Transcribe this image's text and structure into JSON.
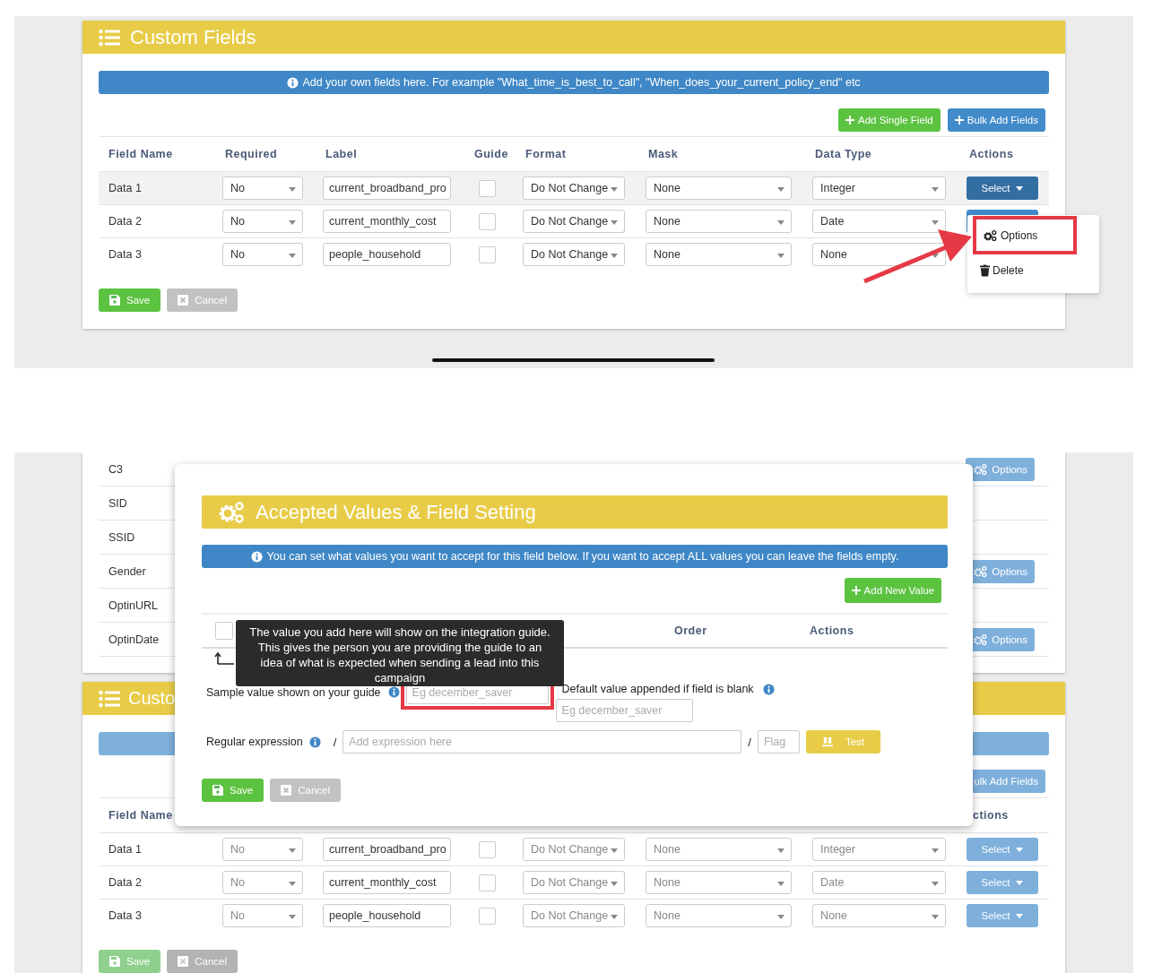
{
  "top": {
    "card": {
      "title": "Custom Fields",
      "info": "Add your own fields here. For example \"What_time_is_best_to_call\", \"When_does_your_current_policy_end\" etc",
      "buttons": [
        {
          "label": "Add Single Field",
          "kind": "success"
        },
        {
          "label": "Bulk Add Fields",
          "kind": "primary"
        }
      ],
      "columns": [
        "Field Name",
        "Required",
        "Label",
        "Guide",
        "Format",
        "Mask",
        "Data Type",
        "Actions"
      ],
      "rows": [
        {
          "name": "Data 1",
          "required": "No",
          "label": "current_broadband_pro",
          "guide": false,
          "format": "Do Not Change",
          "mask": "None",
          "data_type": "Integer",
          "action": {
            "label": "Select",
            "kind": "active"
          },
          "selected": true
        },
        {
          "name": "Data 2",
          "required": "No",
          "label": "current_monthly_cost",
          "guide": false,
          "format": "Do Not Change",
          "mask": "None",
          "data_type": "Date",
          "action": {
            "kind": "covered"
          },
          "selected": false
        },
        {
          "name": "Data 3",
          "required": "No",
          "label": "people_household",
          "guide": false,
          "format": "Do Not Change",
          "mask": "None",
          "data_type": "None",
          "selected": false
        }
      ],
      "footer_buttons": [
        {
          "label": "Save",
          "kind": "save"
        },
        {
          "label": "Cancel",
          "kind": "cancel"
        }
      ]
    },
    "dropdown_menu": {
      "items": [
        {
          "label": "Options",
          "kind": "options",
          "annotated": true
        },
        {
          "label": "Delete",
          "kind": "delete",
          "annotated": false
        }
      ]
    }
  },
  "bottom": {
    "background_rows": [
      {
        "name": "C3",
        "action": "Options"
      },
      {
        "name": "SID"
      },
      {
        "name": "SSID"
      },
      {
        "name": "Gender",
        "action": "Options"
      },
      {
        "name": "OptinURL"
      },
      {
        "name": "OptinDate",
        "action": "Options"
      }
    ],
    "card": {
      "title": "Custo",
      "buttons": [
        {
          "label": "ulk Add Fields",
          "kind": "primary"
        }
      ],
      "columns": [
        "Field Name",
        "ctions"
      ],
      "rows": [
        {
          "name": "Data 1",
          "required": "No",
          "label": "current_broadband_pro",
          "guide": false,
          "format": "Do Not Change",
          "mask": "None",
          "data_type": "Integer",
          "action": {
            "label": "Select",
            "kind": "normal"
          },
          "selected": false
        },
        {
          "name": "Data 2",
          "required": "No",
          "label": "current_monthly_cost",
          "guide": false,
          "format": "Do Not Change",
          "mask": "None",
          "data_type": "Date",
          "action": {
            "label": "Select",
            "kind": "normal"
          },
          "selected": false
        },
        {
          "name": "Data 3",
          "required": "No",
          "label": "people_household",
          "guide": false,
          "format": "Do Not Change",
          "mask": "None",
          "data_type": "None",
          "action": {
            "label": "Select",
            "kind": "normal"
          },
          "selected": false
        }
      ],
      "footer_buttons": [
        {
          "label": "Save",
          "kind": "save"
        },
        {
          "label": "Cancel",
          "kind": "cancel"
        }
      ]
    },
    "modal": {
      "title": "Accepted Values & Field Setting",
      "info": "You can set what values you want to accept for this field below. If you want to accept ALL values you can leave the fields empty.",
      "add_button": "Add New Value",
      "columns": [
        "Order",
        "Actions"
      ],
      "select_all_checked": false,
      "tooltip": "The value you add here will show on the integration guide. This gives the person you are providing the guide to an idea of what is expected when sending a lead into this campaign",
      "sample": {
        "label": "Sample value shown on your guide",
        "placeholder": "Eg december_saver",
        "annotated": true
      },
      "default": {
        "label": "Default value appended if field is blank",
        "placeholder": "Eg december_saver"
      },
      "regex": {
        "label": "Regular expression",
        "open_slash": "/",
        "placeholder": "Add expression here",
        "close_slash": "/",
        "flag_placeholder": "Flag",
        "test_button": "Test"
      },
      "footer_buttons": [
        {
          "label": "Save",
          "kind": "save"
        },
        {
          "label": "Cancel",
          "kind": "cancel"
        }
      ]
    }
  }
}
